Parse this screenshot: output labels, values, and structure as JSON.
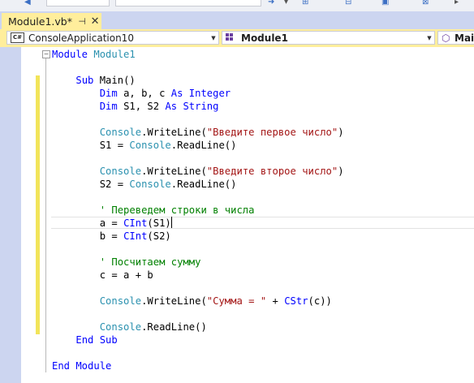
{
  "tab": {
    "title": "Module1.vb*",
    "pin_icon": "pin-icon",
    "close_icon": "close-icon"
  },
  "navbar": {
    "project": "ConsoleApplication10",
    "project_icon_text": "C#",
    "type": "Module1",
    "member": "Main"
  },
  "code_lines": [
    [
      {
        "t": "Module ",
        "c": "kw"
      },
      {
        "t": "Module1",
        "c": "ty"
      }
    ],
    [],
    [
      {
        "t": "    "
      },
      {
        "t": "Sub ",
        "c": "kw"
      },
      {
        "t": "Main()"
      }
    ],
    [
      {
        "t": "        "
      },
      {
        "t": "Dim ",
        "c": "kw"
      },
      {
        "t": "a, b, c "
      },
      {
        "t": "As Integer",
        "c": "kw"
      }
    ],
    [
      {
        "t": "        "
      },
      {
        "t": "Dim ",
        "c": "kw"
      },
      {
        "t": "S1, S2 "
      },
      {
        "t": "As String",
        "c": "kw"
      }
    ],
    [],
    [
      {
        "t": "        "
      },
      {
        "t": "Console",
        "c": "ty"
      },
      {
        "t": ".WriteLine("
      },
      {
        "t": "\"Введите первое число\"",
        "c": "st"
      },
      {
        "t": ")"
      }
    ],
    [
      {
        "t": "        S1 = "
      },
      {
        "t": "Console",
        "c": "ty"
      },
      {
        "t": ".ReadLine()"
      }
    ],
    [],
    [
      {
        "t": "        "
      },
      {
        "t": "Console",
        "c": "ty"
      },
      {
        "t": ".WriteLine("
      },
      {
        "t": "\"Введите второе число\"",
        "c": "st"
      },
      {
        "t": ")"
      }
    ],
    [
      {
        "t": "        S2 = "
      },
      {
        "t": "Console",
        "c": "ty"
      },
      {
        "t": ".ReadLine()"
      }
    ],
    [],
    [
      {
        "t": "        "
      },
      {
        "t": "' Переведем строки в числа",
        "c": "cm"
      }
    ],
    [
      {
        "t": "        a = "
      },
      {
        "t": "CInt",
        "c": "kw"
      },
      {
        "t": "(S1)"
      },
      {
        "t": "",
        "c": "caret"
      }
    ],
    [
      {
        "t": "        b = "
      },
      {
        "t": "CInt",
        "c": "kw"
      },
      {
        "t": "(S2)"
      }
    ],
    [],
    [
      {
        "t": "        "
      },
      {
        "t": "' Посчитаем сумму",
        "c": "cm"
      }
    ],
    [
      {
        "t": "        c = a + b"
      }
    ],
    [],
    [
      {
        "t": "        "
      },
      {
        "t": "Console",
        "c": "ty"
      },
      {
        "t": ".WriteLine("
      },
      {
        "t": "\"Сумма = \"",
        "c": "st"
      },
      {
        "t": " + "
      },
      {
        "t": "CStr",
        "c": "kw"
      },
      {
        "t": "(c))"
      }
    ],
    [],
    [
      {
        "t": "        "
      },
      {
        "t": "Console",
        "c": "ty"
      },
      {
        "t": ".ReadLine()"
      }
    ],
    [
      {
        "t": "    "
      },
      {
        "t": "End Sub",
        "c": "kw"
      }
    ],
    [],
    [
      {
        "t": "End Module",
        "c": "kw"
      }
    ]
  ],
  "colors": {
    "tab_active": "#ffee9c",
    "keyword": "#0000ff",
    "type": "#2b91af",
    "string": "#a31515",
    "comment": "#008000",
    "change_marker": "#f2e45a"
  }
}
